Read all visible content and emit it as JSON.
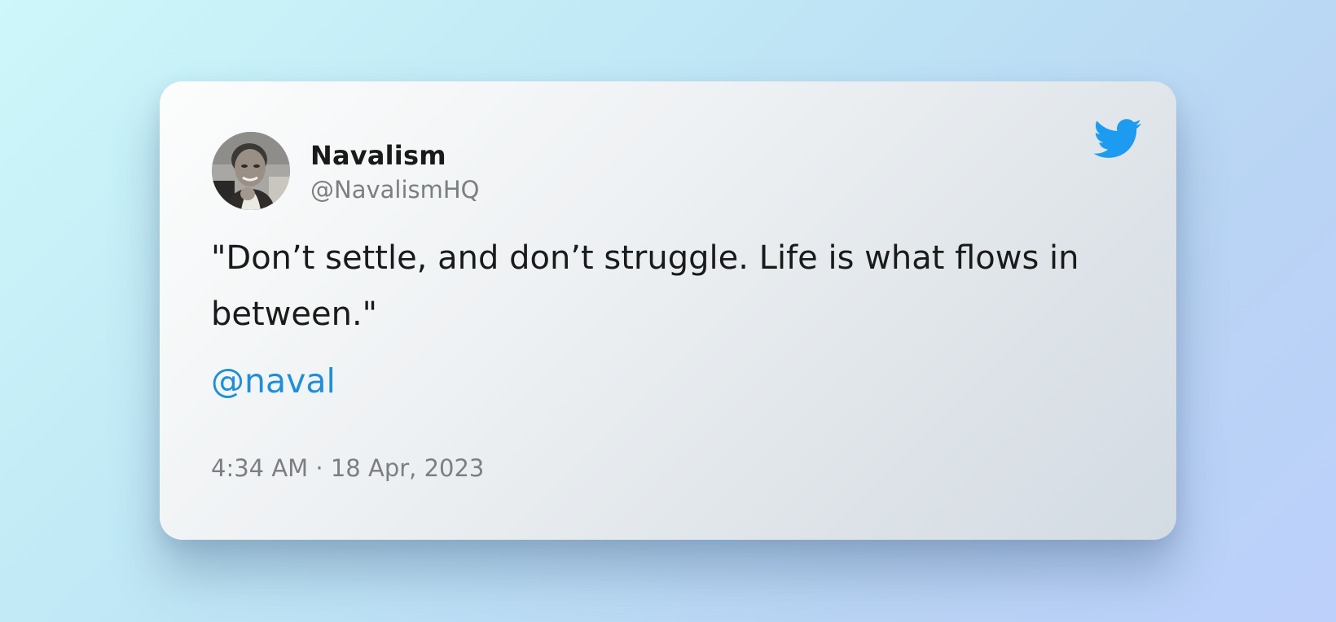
{
  "tweet": {
    "author_name": "Navalism",
    "author_handle": "@NavalismHQ",
    "text": "\"Don’t settle, and don’t struggle. Life is what flows in between.\"",
    "mention": "@naval",
    "timestamp": "4:34 AM · 18 Apr, 2023"
  },
  "icons": {
    "brand": "twitter-bird-icon",
    "avatar": "avatar"
  },
  "colors": {
    "mention": "#1f8fd8",
    "twitter_brand": "#1d9bf0",
    "secondary_text": "#7c7e82",
    "primary_text": "#1a1a1a"
  }
}
